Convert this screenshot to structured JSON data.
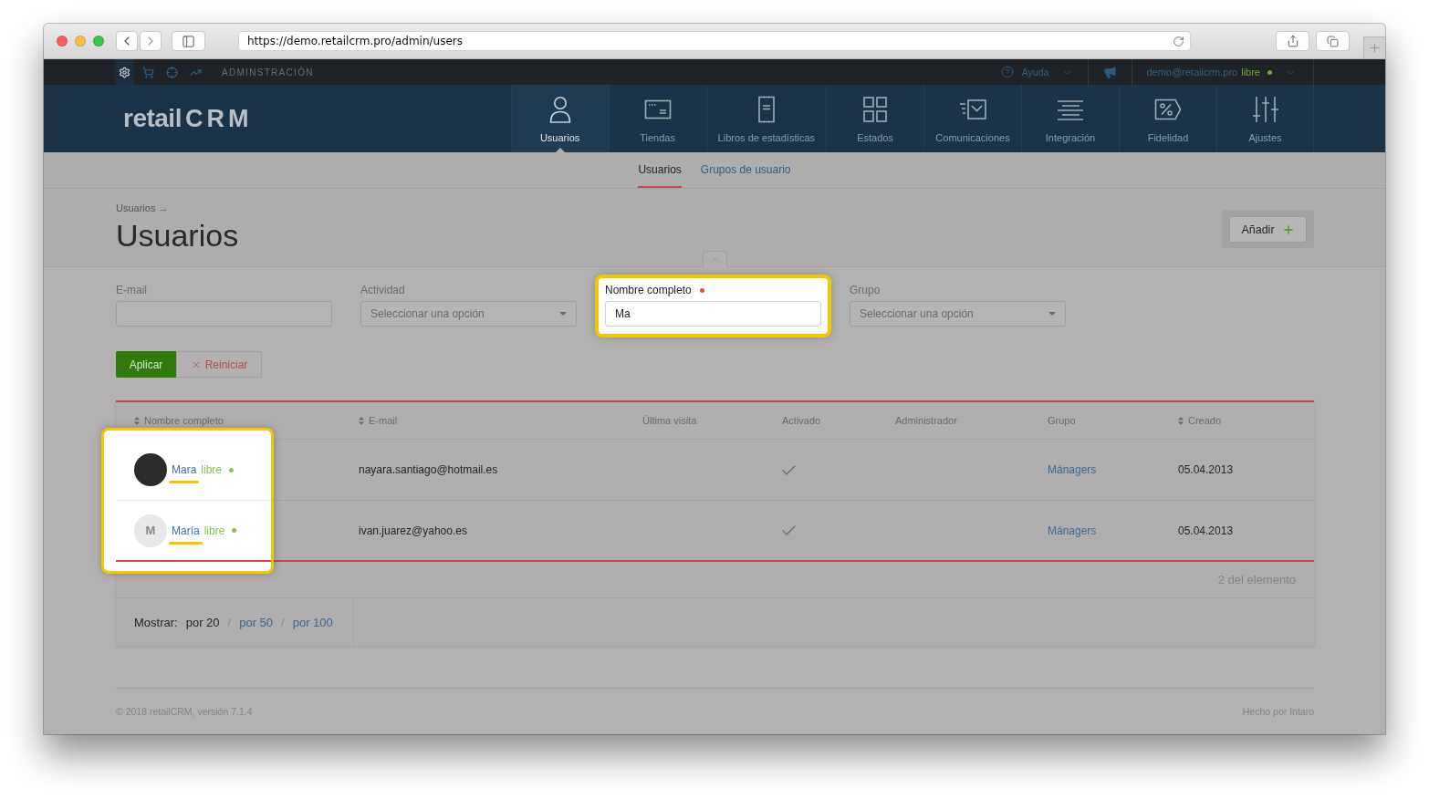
{
  "browser": {
    "url": "https://demo.retailcrm.pro/admin/users"
  },
  "admin_bar": {
    "section": "ADMINSTRACIÓN",
    "help": "Ayuda",
    "user_email": "demo@retailcrm.pro",
    "user_status": "libre",
    "online": true
  },
  "logo": {
    "text": "retail",
    "mark": "CRM"
  },
  "nav": [
    {
      "label": "Usuarios",
      "selected": true
    },
    {
      "label": "Tiendas",
      "selected": false
    },
    {
      "label": "Libros de estadísticas",
      "selected": false
    },
    {
      "label": "Estados",
      "selected": false
    },
    {
      "label": "Comunicaciones",
      "selected": false
    },
    {
      "label": "Integración",
      "selected": false
    },
    {
      "label": "Fidelidad",
      "selected": false
    },
    {
      "label": "Ajustes",
      "selected": false
    }
  ],
  "subnav": [
    {
      "label": "Usuarios",
      "selected": true
    },
    {
      "label": "Grupos de usuario",
      "selected": false
    }
  ],
  "breadcrumb": "Usuarios →",
  "title": "Usuarios",
  "add_button": "Añadir",
  "filters": [
    {
      "kind": "text",
      "label": "E-mail",
      "active": false,
      "highlighted": false
    },
    {
      "kind": "select",
      "label": "Actividad",
      "placeholder": "Seleccionar una opción",
      "active": false,
      "highlighted": false
    },
    {
      "kind": "text",
      "label": "Nombre completo",
      "value": "Ma",
      "active": true,
      "highlighted": true
    },
    {
      "kind": "select",
      "label": "Grupo",
      "placeholder": "Seleccionar una opción",
      "active": false,
      "highlighted": false
    }
  ],
  "apply_button": "Aplicar",
  "reset_button": "Reiniciar",
  "table": {
    "name_highlight": true,
    "columns": [
      {
        "label": "Nombre completo",
        "sortable": true
      },
      {
        "label": "E-mail",
        "sortable": true
      },
      {
        "label": "Última visita",
        "sortable": false
      },
      {
        "label": "Activado",
        "sortable": false
      },
      {
        "label": "Administrador",
        "sortable": false
      },
      {
        "label": "Grupo",
        "sortable": false
      },
      {
        "label": "Creado",
        "sortable": true
      }
    ],
    "rows": [
      {
        "name": "Mara",
        "status": "libre",
        "online": true,
        "avatar": {
          "kind": "photo"
        },
        "email": "nayara.santiago@hotmail.es",
        "activated": true,
        "group": "Mánagers",
        "created": "05.04.2013"
      },
      {
        "name": "María",
        "status": "libre",
        "online": true,
        "avatar": {
          "kind": "initial",
          "initial": "M"
        },
        "email": "ivan.juarez@yahoo.es",
        "activated": true,
        "group": "Mánagers",
        "created": "05.04.2013"
      }
    ]
  },
  "summary": "2 del elemento",
  "pager": {
    "label": "Mostrar:",
    "separator": "/",
    "options": [
      {
        "label": "por 20",
        "selected": true
      },
      {
        "label": "por 50",
        "selected": false
      },
      {
        "label": "por 100",
        "selected": false
      }
    ]
  },
  "footer": {
    "copyright": "© 2018 retailCRM, versión 7.1.4",
    "credit": "Hecho por Intaro"
  }
}
